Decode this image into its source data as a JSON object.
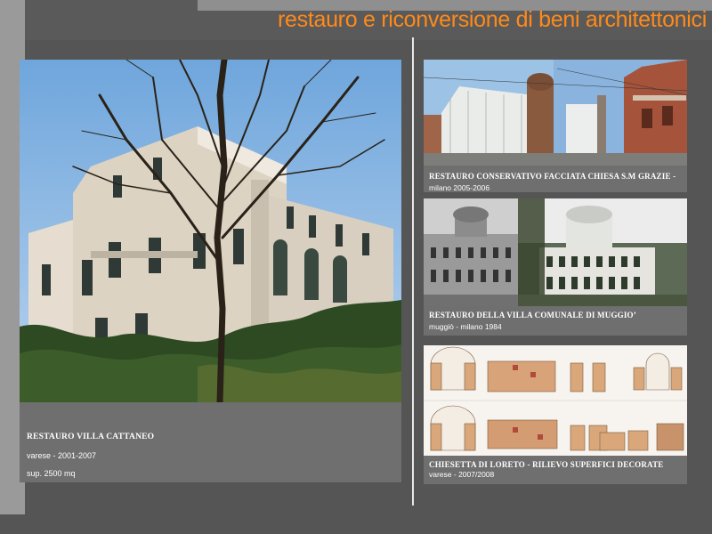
{
  "header": {
    "title": "restauro e riconversione di beni architettonici"
  },
  "main_project": {
    "title": "RESTAURO VILLA CATTANEO",
    "location_years": "varese - 2001-2007",
    "area": "sup. 2500 mq"
  },
  "projects": [
    {
      "title": "RESTAURO CONSERVATIVO FACCIATA CHIESA S.M GRAZIE  -",
      "subtitle": "milano 2005-2006"
    },
    {
      "title": "RESTAURO DELLA VILLA COMUNALE DI MUGGIO’",
      "subtitle": "muggiò - milano 1984"
    },
    {
      "title": "CHIESETTA DI LORETO  - RILIEVO SUPERFICI DECORATE",
      "subtitle": "varese   - 2007/2008"
    }
  ],
  "colors": {
    "title_orange": "#ff8a1a",
    "background": "#555555",
    "caption_panel": "#6f6f6f"
  }
}
